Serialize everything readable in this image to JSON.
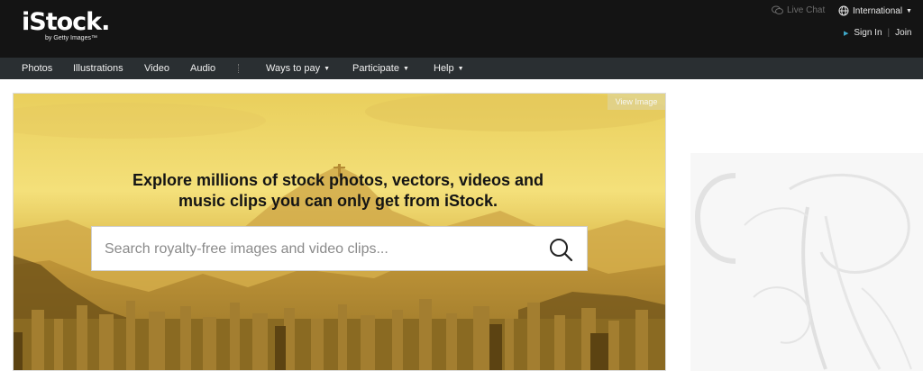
{
  "header": {
    "logo_main": "iStock.",
    "logo_sub": "by Getty Images™",
    "live_chat": "Live Chat",
    "region": "International",
    "sign_in": "Sign In",
    "join": "Join",
    "separator": "|"
  },
  "nav": {
    "items": [
      {
        "label": "Photos"
      },
      {
        "label": "Illustrations"
      },
      {
        "label": "Video"
      },
      {
        "label": "Audio"
      },
      {
        "label": "Ways to pay"
      },
      {
        "label": "Participate"
      },
      {
        "label": "Help"
      }
    ]
  },
  "hero": {
    "view_image": "View Image",
    "headline_line1": "Explore millions of stock photos, vectors, videos and",
    "headline_line2": "music clips you can only get from iStock.",
    "search_placeholder": "Search royalty-free images and video clips..."
  },
  "icons": {
    "live_chat": "chat-bubble-icon",
    "region": "globe-icon",
    "sign_in": "triangle-right-icon",
    "search": "magnifier-icon",
    "dropdown": "caret-down-icon"
  },
  "colors": {
    "header_bg": "#141414",
    "nav_bg": "#2a2f32",
    "accent_arrow": "#3fa9c9",
    "hero_sky": "#f2d96a",
    "hero_city": "#8a6a22"
  }
}
